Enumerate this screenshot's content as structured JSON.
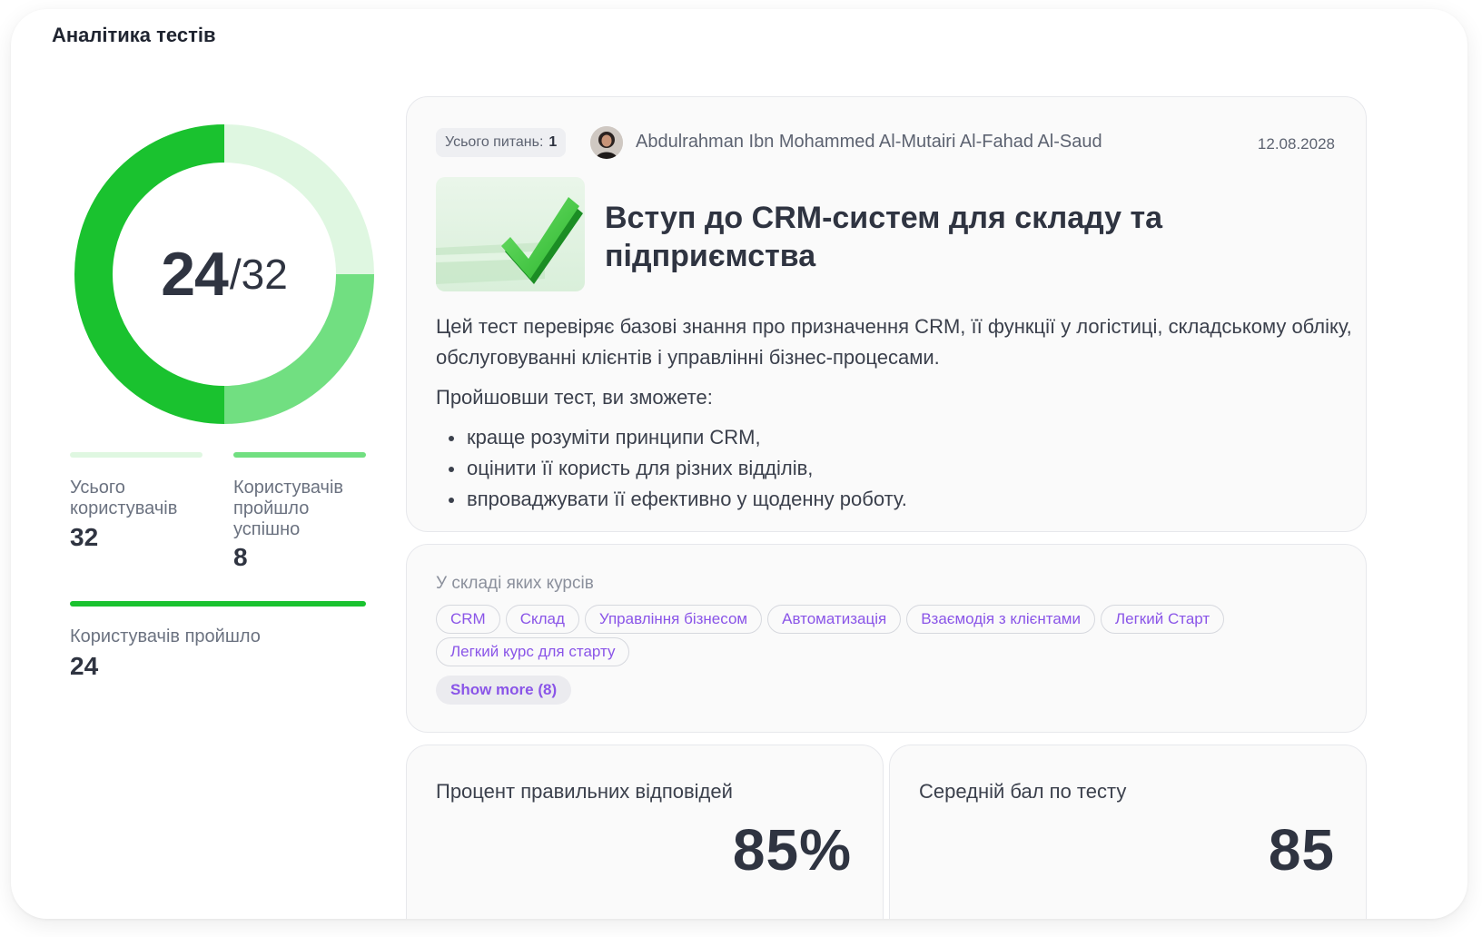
{
  "page": {
    "title": "Аналітика тестів"
  },
  "donut": {
    "passed": "24",
    "separator": "/",
    "total": "32",
    "segments": [
      {
        "name": "passed_not_successful",
        "value": 16,
        "color": "#1ac22f"
      },
      {
        "name": "passed_successfully",
        "value": 8,
        "color": "#71df81"
      },
      {
        "name": "not_passed",
        "value": 8,
        "color": "#dff7e1"
      }
    ]
  },
  "stats": {
    "total_users": {
      "label": "Усього користувачів",
      "value": "32",
      "color": "#dff7e1"
    },
    "passed_successfully": {
      "label": "Користувачів пройшло успішно",
      "value": "8",
      "color": "#71df81"
    },
    "passed": {
      "label": "Користувачів пройшло",
      "value": "24",
      "color": "#1ac22f"
    }
  },
  "test": {
    "questions_label": "Усього питань:",
    "questions_count": "1",
    "author": "Abdulrahman Ibn Mohammed Al-Mutairi Al-Fahad Al-Saud",
    "date": "12.08.2028",
    "title": "Вступ до CRM-систем для складу та підприємства",
    "description": "Цей тест перевіряє базові знання про призначення CRM, її функції у логістиці, складському обліку, обслуговуванні клієнтів і управлінні бізнес-процесами.",
    "outcomes_intro": "Пройшовши тест, ви зможете:",
    "outcomes": [
      "краще розуміти принципи CRM,",
      "оцінити її користь для різних відділів,",
      "впроваджувати її ефективно у щоденну роботу."
    ]
  },
  "courses": {
    "label": "У складі яких курсів",
    "chips": [
      "CRM",
      "Склад",
      "Управління бізнесом",
      "Автоматизація",
      "Взаємодія з клієнтами",
      "Легкий Старт",
      "Легкий курс для старту"
    ],
    "show_more": "Show more (8)"
  },
  "metrics": {
    "correct_percent": {
      "label": "Процент правильних відповідей",
      "value": "85%"
    },
    "average_score": {
      "label": "Середній бал по тесту",
      "value": "85"
    }
  }
}
